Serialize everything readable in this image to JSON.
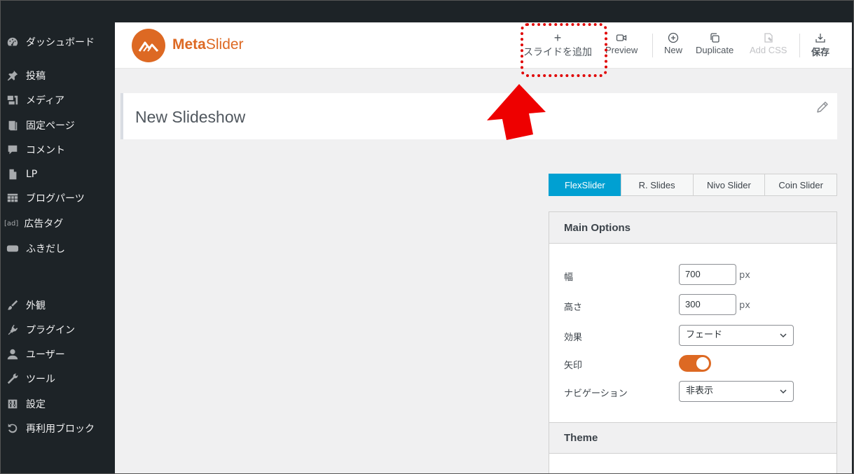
{
  "sidebar": {
    "items": [
      {
        "label": "ダッシュボード",
        "icon": "dashboard-icon"
      },
      {
        "label": "投稿",
        "icon": "pin-icon"
      },
      {
        "label": "メディア",
        "icon": "media-icon"
      },
      {
        "label": "固定ページ",
        "icon": "page-icon"
      },
      {
        "label": "コメント",
        "icon": "comment-icon"
      },
      {
        "label": "LP",
        "icon": "document-icon"
      },
      {
        "label": "ブログパーツ",
        "icon": "grid-icon"
      },
      {
        "label": "広告タグ",
        "icon": "ad-icon"
      },
      {
        "label": "ふきだし",
        "icon": "bubble-icon"
      },
      {
        "label": "外観",
        "icon": "brush-icon"
      },
      {
        "label": "プラグイン",
        "icon": "plugin-icon"
      },
      {
        "label": "ユーザー",
        "icon": "user-icon"
      },
      {
        "label": "ツール",
        "icon": "wrench-icon"
      },
      {
        "label": "設定",
        "icon": "settings-icon"
      },
      {
        "label": "再利用ブロック",
        "icon": "reuse-icon"
      }
    ],
    "ad_icon_text": "[ad]"
  },
  "header": {
    "logo_meta": "Meta",
    "logo_slider": "Slider",
    "toolbar": {
      "add_slide": "スライドを追加",
      "preview": "Preview",
      "new": "New",
      "duplicate": "Duplicate",
      "add_css": "Add CSS",
      "save": "保存"
    }
  },
  "slideshow": {
    "title": "New Slideshow"
  },
  "tabs": [
    "FlexSlider",
    "R. Slides",
    "Nivo Slider",
    "Coin Slider"
  ],
  "active_tab": "FlexSlider",
  "main_options": {
    "heading": "Main Options",
    "width_label": "幅",
    "width_value": "700",
    "height_label": "高さ",
    "height_value": "300",
    "unit": "px",
    "effect_label": "効果",
    "effect_value": "フェード",
    "arrows_label": "矢印",
    "arrows_on": true,
    "navigation_label": "ナビゲーション",
    "navigation_value": "非表示"
  },
  "theme": {
    "heading": "Theme"
  },
  "colors": {
    "accent_orange": "#dd6923",
    "tab_active": "#00a0d2",
    "highlight_red": "#e00000",
    "sidebar_bg": "#1d2327"
  }
}
